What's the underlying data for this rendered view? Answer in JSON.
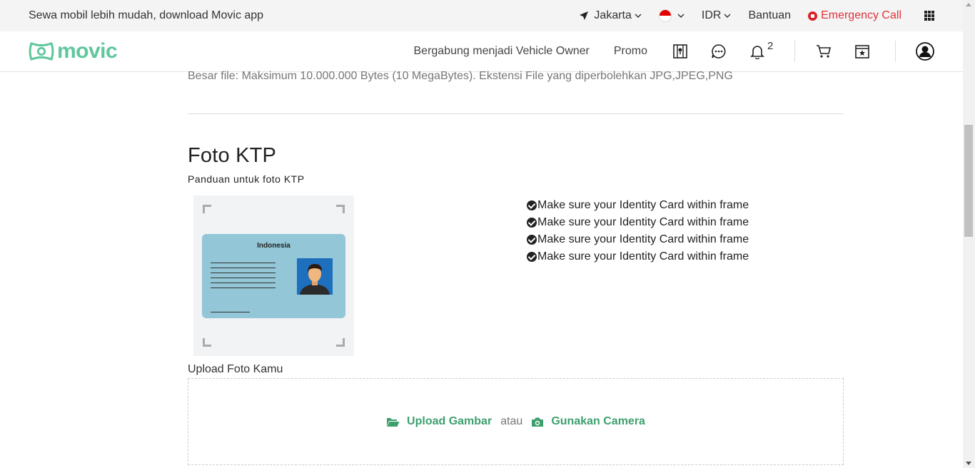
{
  "topbar": {
    "promo_text": "Sewa mobil lebih mudah, download Movic app",
    "city": "Jakarta",
    "currency": "IDR",
    "help": "Bantuan",
    "emergency": "Emergency Call"
  },
  "navbar": {
    "logo_text": "movic",
    "join_label": "Bergabung menjadi Vehicle Owner",
    "promo_label": "Promo",
    "notification_count": "2"
  },
  "content": {
    "file_note": "Besar file: Maksimum 10.000.000 Bytes (10 MegaBytes). Ekstensi File yang diperbolehkan JPG,JPEG,PNG",
    "section_title": "Foto KTP",
    "section_subtitle": "Panduan untuk foto KTP",
    "card_country": "Indonesia",
    "checklist": [
      "Make sure your Identity Card within frame",
      "Make sure your Identity Card within frame",
      "Make sure your Identity Card within frame",
      "Make sure your Identity Card within frame"
    ],
    "upload_label": "Upload Foto Kamu",
    "upload_button": "Upload Gambar",
    "or_text": "atau",
    "camera_button": "Gunakan Camera"
  },
  "colors": {
    "brand": "#5fc79c",
    "action": "#3e9f6e",
    "emergency": "#e0323c"
  },
  "icons": [
    "location-arrow-icon",
    "chevron-down-icon",
    "flag-icon",
    "emergency-icon",
    "apps-grid-icon",
    "map-icon",
    "chat-icon",
    "bell-icon",
    "cart-icon",
    "booking-icon",
    "user-icon",
    "check-circle-icon",
    "folder-open-icon",
    "camera-icon"
  ]
}
